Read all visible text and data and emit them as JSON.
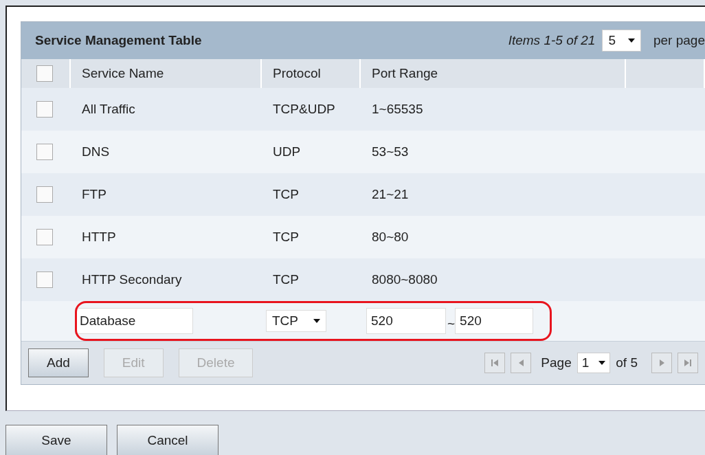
{
  "table": {
    "title": "Service Management Table",
    "items_label": "Items 1-5 of 21",
    "per_page_value": "5",
    "per_page_label": "per page",
    "header_checkbox": {
      "checked": false
    },
    "columns": [
      "Service Name",
      "Protocol",
      "Port Range"
    ],
    "rows": [
      {
        "checked": false,
        "name": "All Traffic",
        "protocol": "TCP&UDP",
        "port_range": "1~65535"
      },
      {
        "checked": false,
        "name": "DNS",
        "protocol": "UDP",
        "port_range": "53~53"
      },
      {
        "checked": false,
        "name": "FTP",
        "protocol": "TCP",
        "port_range": "21~21"
      },
      {
        "checked": false,
        "name": "HTTP",
        "protocol": "TCP",
        "port_range": "80~80"
      },
      {
        "checked": false,
        "name": "HTTP Secondary",
        "protocol": "TCP",
        "port_range": "8080~8080"
      }
    ],
    "new_row": {
      "name": "Database",
      "protocol": "TCP",
      "port_start": "520",
      "separator": "~",
      "port_end": "520",
      "highlighted": true
    },
    "actions": [
      {
        "label": "Add",
        "disabled": false
      },
      {
        "label": "Edit",
        "disabled": true
      },
      {
        "label": "Delete",
        "disabled": true
      }
    ],
    "pagination": {
      "page_label": "Page",
      "page_value": "1",
      "of_label": "of 5"
    }
  },
  "form_buttons": [
    {
      "label": "Save"
    },
    {
      "label": "Cancel"
    }
  ]
}
